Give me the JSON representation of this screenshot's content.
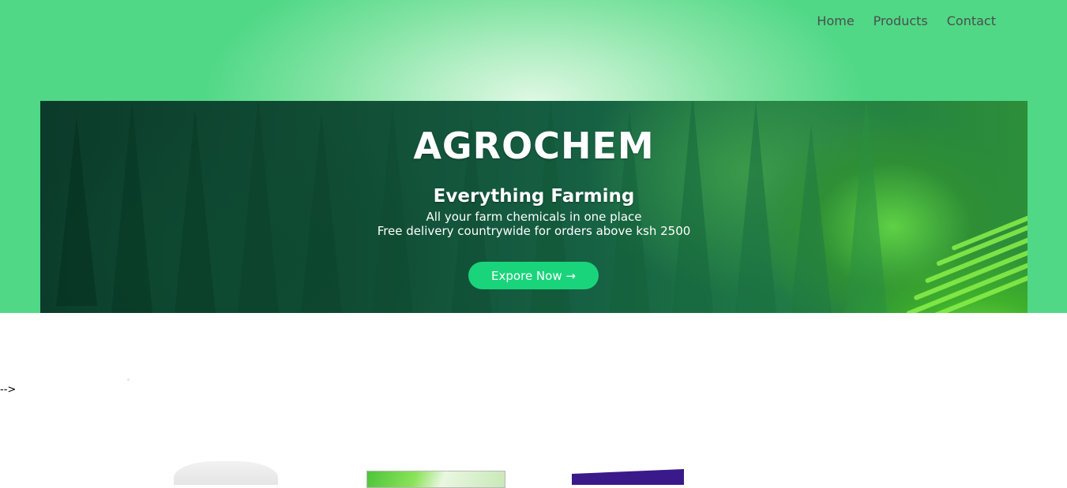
{
  "nav": {
    "items": [
      {
        "label": "Home"
      },
      {
        "label": "Products"
      },
      {
        "label": "Contact"
      }
    ]
  },
  "hero": {
    "title": "AGROCHEM",
    "subtitle": "Everything Farming",
    "line1": "All your farm chemicals in one place",
    "line2": "Free delivery countrywide for orders above ksh 2500",
    "cta_label": "Expore Now →"
  },
  "stray_text": "-->",
  "colors": {
    "header_green": "#50d886",
    "cta_green": "#19d47a",
    "nav_text": "#4a4f4c"
  }
}
